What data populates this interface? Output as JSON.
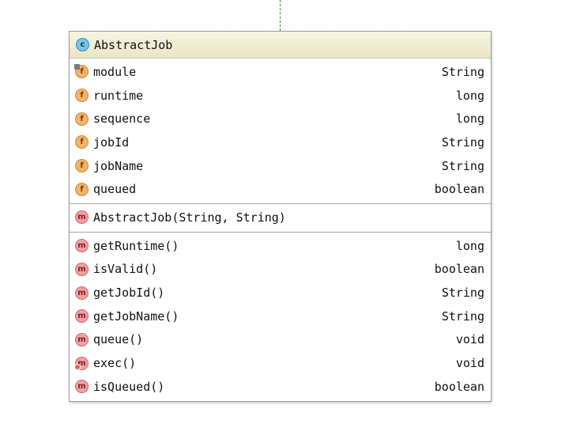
{
  "class": {
    "name": "AbstractJob",
    "icon": "class-icon",
    "icon_letter": "c"
  },
  "fields": [
    {
      "name": "module",
      "type": "String",
      "icon": "field-icon",
      "letter": "f"
    },
    {
      "name": "runtime",
      "type": "long",
      "icon": "field-icon",
      "letter": "f"
    },
    {
      "name": "sequence",
      "type": "long",
      "icon": "field-icon",
      "letter": "f"
    },
    {
      "name": "jobId",
      "type": "String",
      "icon": "field-icon",
      "letter": "f"
    },
    {
      "name": "jobName",
      "type": "String",
      "icon": "field-icon",
      "letter": "f"
    },
    {
      "name": "queued",
      "type": "boolean",
      "icon": "field-icon",
      "letter": "f"
    }
  ],
  "constructors": [
    {
      "name": "AbstractJob(String, String)",
      "type": "",
      "icon": "method-icon",
      "letter": "m"
    }
  ],
  "methods": [
    {
      "name": "getRuntime()",
      "type": "long",
      "icon": "method-icon",
      "letter": "m"
    },
    {
      "name": "isValid()",
      "type": "boolean",
      "icon": "method-icon",
      "letter": "m"
    },
    {
      "name": "getJobId()",
      "type": "String",
      "icon": "method-icon",
      "letter": "m"
    },
    {
      "name": "getJobName()",
      "type": "String",
      "icon": "method-icon",
      "letter": "m"
    },
    {
      "name": "queue()",
      "type": "void",
      "icon": "method-icon",
      "letter": "m"
    },
    {
      "name": "exec()",
      "type": "void",
      "icon": "method-icon",
      "letter": "m"
    },
    {
      "name": "isQueued()",
      "type": "boolean",
      "icon": "method-icon",
      "letter": "m"
    }
  ],
  "colors": {
    "header_bg": "#ece9cc",
    "field_badge": "#f2b36b",
    "method_badge": "#f2a0a0",
    "class_badge": "#7cc4e8",
    "connector": "#2e8b2e"
  }
}
